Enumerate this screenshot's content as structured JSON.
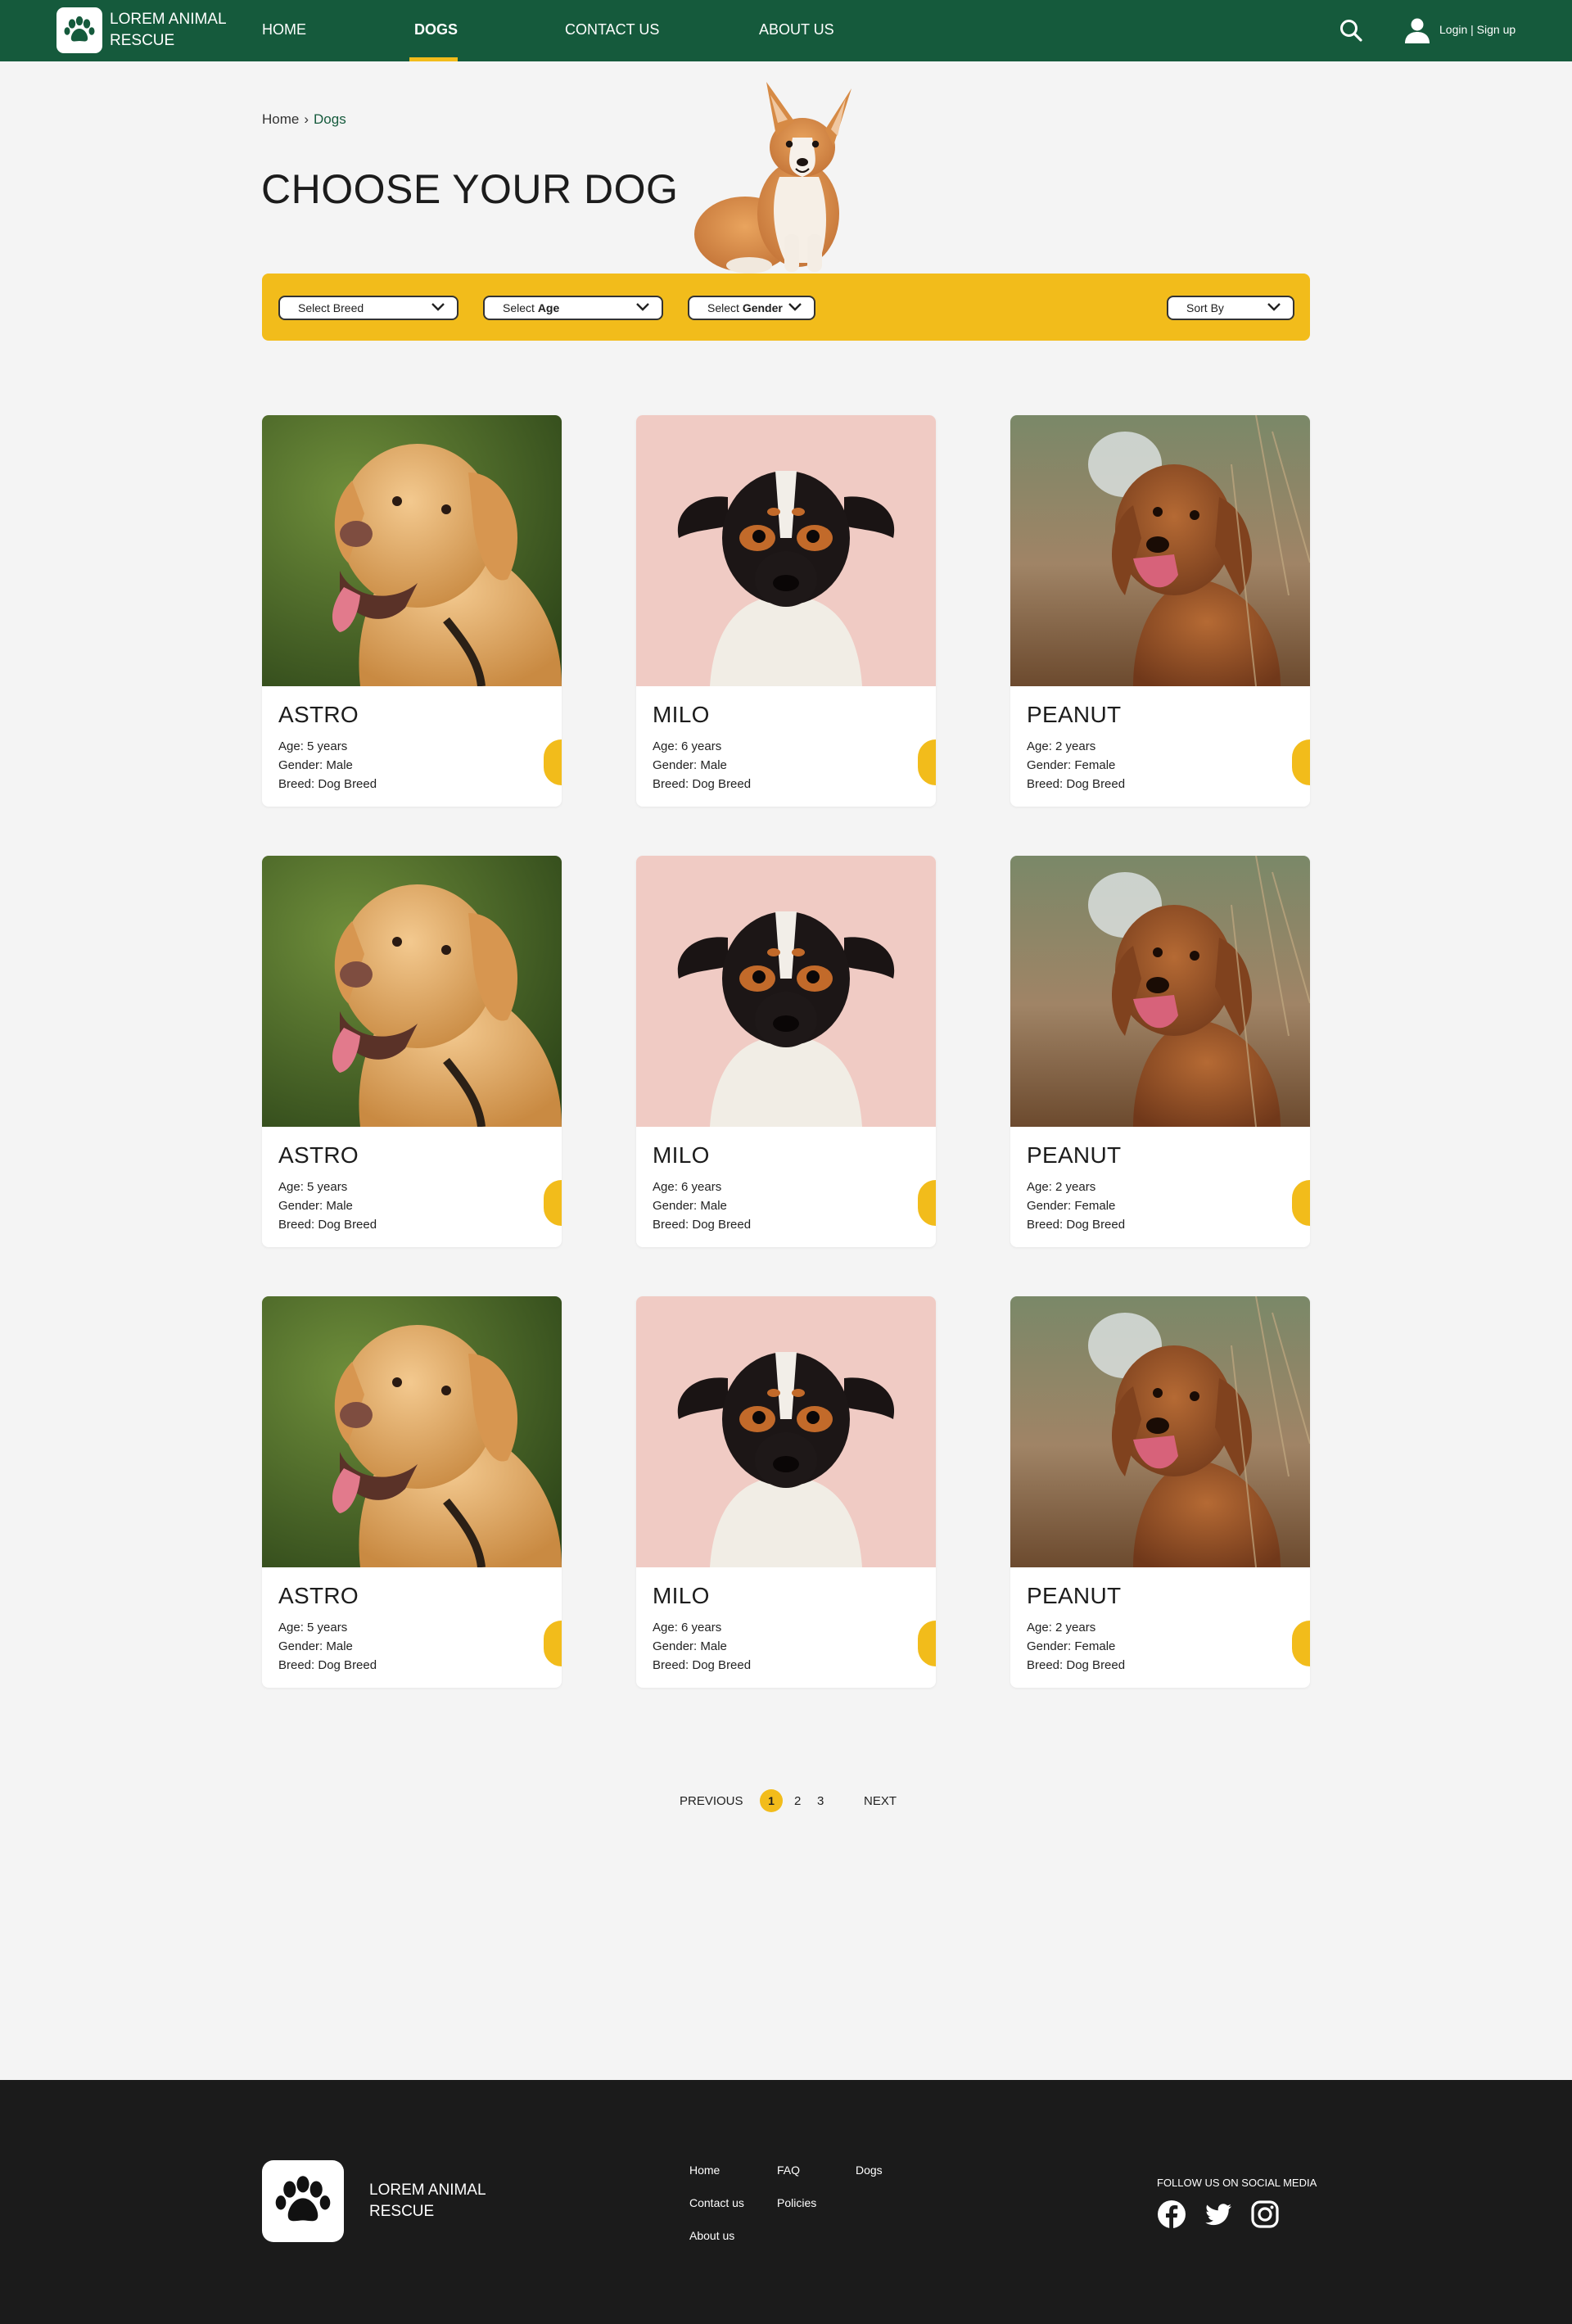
{
  "header": {
    "logo_text": "LOREM ANIMAL RESCUE",
    "nav": [
      {
        "label": "HOME"
      },
      {
        "label": "DOGS",
        "active": true
      },
      {
        "label": "CONTACT US"
      },
      {
        "label": "ABOUT US"
      }
    ],
    "auth_label": "Login | Sign up"
  },
  "breadcrumb": {
    "home": "Home",
    "separator": "›",
    "current": "Dogs"
  },
  "page_title": "CHOOSE YOUR DOG",
  "filters": {
    "breed_label": "Select Breed",
    "age_prefix": "Select",
    "age_bold": "Age",
    "gender_prefix": "Select",
    "gender_bold": "Gender",
    "sort_label": "Sort By"
  },
  "dogs": [
    {
      "name": "ASTRO",
      "age_key": "Age:",
      "age": "5 years",
      "gender_key": "Gender:",
      "gender": "Male",
      "breed_key": "Breed:",
      "breed": "Dog Breed"
    },
    {
      "name": "MILO",
      "age_key": "Age:",
      "age": "6 years",
      "gender_key": "Gender:",
      "gender": "Male",
      "breed_key": "Breed:",
      "breed": "Dog Breed"
    },
    {
      "name": "PEANUT",
      "age_key": "Age:",
      "age": "2 years",
      "gender_key": "Gender:",
      "gender": "Female",
      "breed_key": "Breed:",
      "breed": "Dog Breed"
    },
    {
      "name": "ASTRO",
      "age_key": "Age:",
      "age": "5 years",
      "gender_key": "Gender:",
      "gender": "Male",
      "breed_key": "Breed:",
      "breed": "Dog Breed"
    },
    {
      "name": "MILO",
      "age_key": "Age:",
      "age": "6 years",
      "gender_key": "Gender:",
      "gender": "Male",
      "breed_key": "Breed:",
      "breed": "Dog Breed"
    },
    {
      "name": "PEANUT",
      "age_key": "Age:",
      "age": "2 years",
      "gender_key": "Gender:",
      "gender": "Female",
      "breed_key": "Breed:",
      "breed": "Dog Breed"
    },
    {
      "name": "ASTRO",
      "age_key": "Age:",
      "age": "5 years",
      "gender_key": "Gender:",
      "gender": "Male",
      "breed_key": "Breed:",
      "breed": "Dog Breed"
    },
    {
      "name": "MILO",
      "age_key": "Age:",
      "age": "6 years",
      "gender_key": "Gender:",
      "gender": "Male",
      "breed_key": "Breed:",
      "breed": "Dog Breed"
    },
    {
      "name": "PEANUT",
      "age_key": "Age:",
      "age": "2 years",
      "gender_key": "Gender:",
      "gender": "Female",
      "breed_key": "Breed:",
      "breed": "Dog Breed"
    }
  ],
  "pagination": {
    "previous": "PREVIOUS",
    "pages": [
      "1",
      "2",
      "3"
    ],
    "next": "NEXT",
    "current": "1"
  },
  "footer": {
    "logo_text": "LOREM ANIMAL RESCUE",
    "links": {
      "home": "Home",
      "faq": "FAQ",
      "dogs": "Dogs",
      "contact": "Contact us",
      "policies": "Policies",
      "about": "About us"
    },
    "social_title": "FOLLOW US ON SOCIAL MEDIA",
    "social_icons": [
      "facebook-icon",
      "twitter-icon",
      "instagram-icon"
    ]
  },
  "colors": {
    "brand_green": "#155a3c",
    "accent_yellow": "#f2bc1b",
    "footer_bg": "#1b1b1b",
    "page_bg": "#f4f4f4"
  }
}
